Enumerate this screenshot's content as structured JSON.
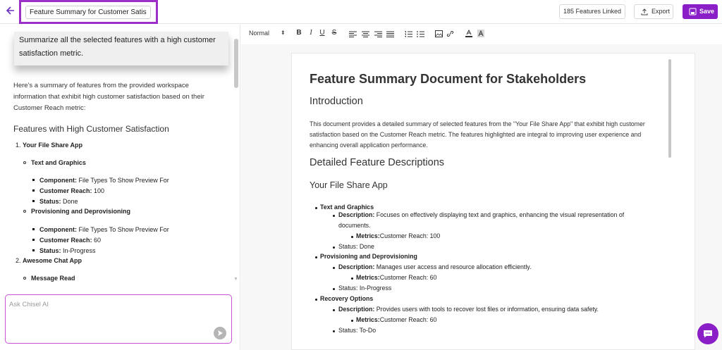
{
  "header": {
    "document_title": "Feature Summary for Customer Satisfacti",
    "features_linked": "185 Features Linked",
    "export_label": "Export",
    "save_label": "Save"
  },
  "chat": {
    "user_prompt": "Summarize all the selected features with a high customer satisfaction metric.",
    "ai_intro": "Here's a summary of features from the provided workspace information that exhibit high customer satisfaction based on their Customer Reach metric:",
    "ai_heading": "Features with High Customer Satisfaction",
    "apps": [
      {
        "number": "1.",
        "name": "Your File Share App",
        "features": [
          {
            "name": "Text and Graphics",
            "component_label": "Component:",
            "component": "File Types To Show Preview For",
            "reach_label": "Customer Reach:",
            "reach": "100",
            "status_label": "Status:",
            "status": "Done"
          },
          {
            "name": "Provisioning and Deprovisioning",
            "component_label": "Component:",
            "component": "File Types To Show Preview For",
            "reach_label": "Customer Reach:",
            "reach": "60",
            "status_label": "Status:",
            "status": "In-Progress"
          }
        ]
      },
      {
        "number": "2.",
        "name": "Awesome Chat App",
        "features": [
          {
            "name": "Message Read"
          }
        ]
      }
    ],
    "input_placeholder": "Ask Chisel AI"
  },
  "toolbar": {
    "format_select": "Normal",
    "format_caret": "⬍",
    "bold": "B",
    "italic": "I",
    "underline": "U",
    "strike": "S"
  },
  "document": {
    "title": "Feature Summary Document for Stakeholders",
    "intro_heading": "Introduction",
    "intro_text": "This document provides a detailed summary of selected features from the \"Your File Share App\" that exhibit high customer satisfaction based on the Customer Reach metric. The features highlighted are integral to improving user experience and enhancing overall application performance.",
    "details_heading": "Detailed Feature Descriptions",
    "app_heading": "Your File Share App",
    "features": [
      {
        "name": "Text and Graphics",
        "desc_label": "Description:",
        "desc": "Focuses on effectively displaying text and graphics, enhancing the visual representation of",
        "desc_cont": "documents.",
        "metrics_label": "Metrics:",
        "metrics": "Customer Reach: 100",
        "status": "Status: Done"
      },
      {
        "name": "Provisioning and Deprovisioning",
        "desc_label": "Description:",
        "desc": "Manages user access and resource allocation efficiently.",
        "metrics_label": "Metrics:",
        "metrics": "Customer Reach: 60",
        "status": "Status: In-Progress"
      },
      {
        "name": "Recovery Options",
        "desc_label": "Description:",
        "desc": "Provides users with tools to recover lost files or information, ensuring data safety.",
        "metrics_label": "Metrics:",
        "metrics": "Customer Reach: 60",
        "status": "Status: To-Do"
      }
    ]
  },
  "icons": {
    "back": "arrow-left-icon",
    "export": "upload-icon",
    "save": "save-icon",
    "send": "send-icon",
    "chat": "chat-bubble-icon"
  },
  "colors": {
    "accent": "#8a1fc7",
    "highlight_border": "#9b30c8"
  }
}
